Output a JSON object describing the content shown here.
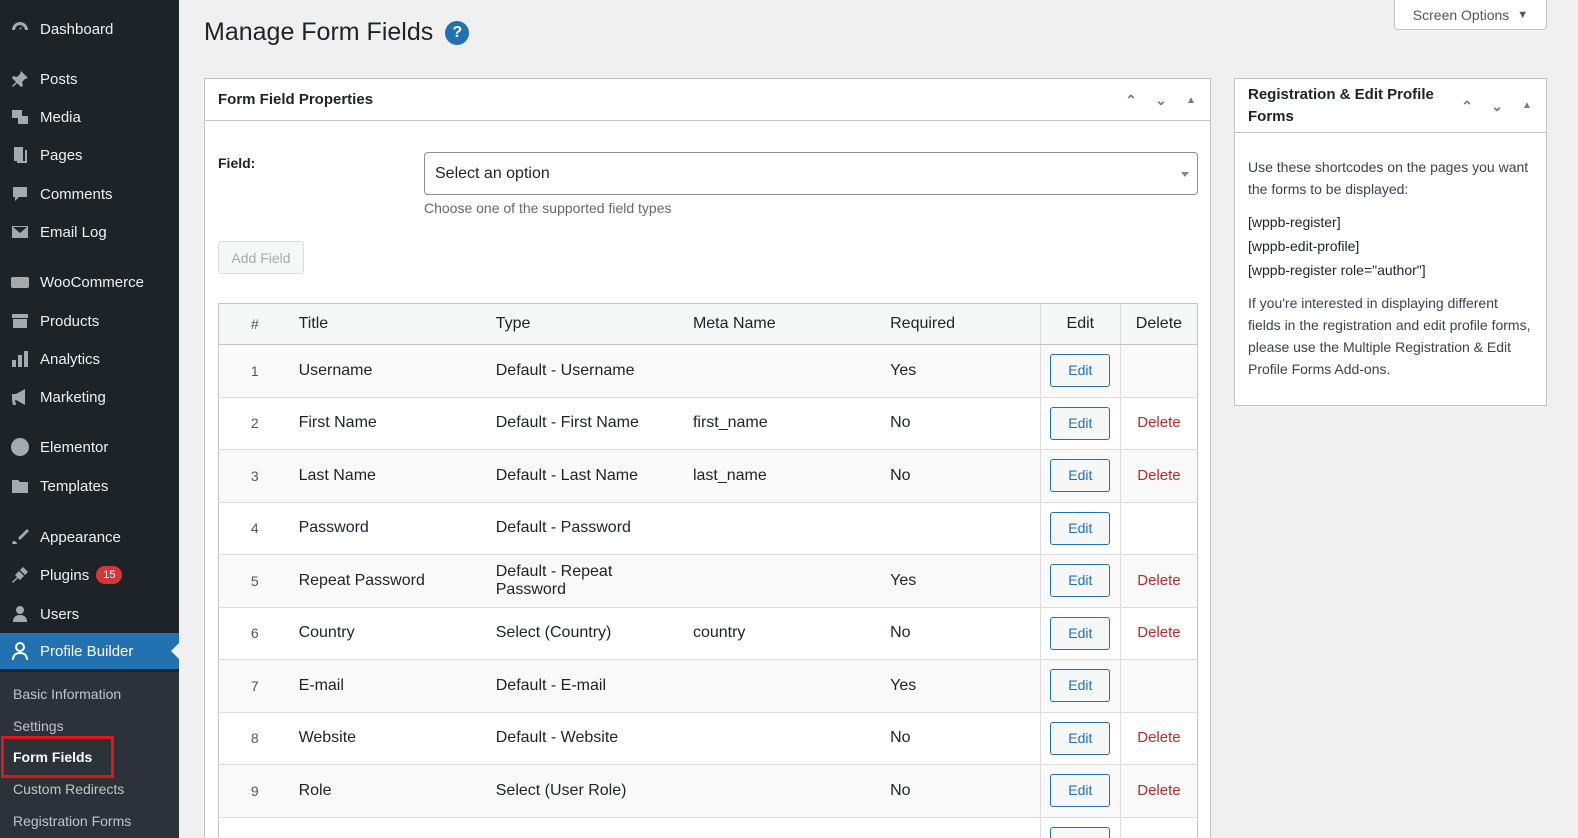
{
  "sidebar": {
    "items": [
      {
        "label": "Dashboard",
        "icon": "dashboard-icon"
      },
      {
        "label": "Posts",
        "icon": "pin-icon"
      },
      {
        "label": "Media",
        "icon": "media-icon"
      },
      {
        "label": "Pages",
        "icon": "pages-icon"
      },
      {
        "label": "Comments",
        "icon": "comment-icon"
      },
      {
        "label": "Email Log",
        "icon": "envelope-icon"
      },
      {
        "label": "WooCommerce",
        "icon": "woo-icon"
      },
      {
        "label": "Products",
        "icon": "archive-icon"
      },
      {
        "label": "Analytics",
        "icon": "bar-chart-icon"
      },
      {
        "label": "Marketing",
        "icon": "megaphone-icon"
      },
      {
        "label": "Elementor",
        "icon": "elementor-icon"
      },
      {
        "label": "Templates",
        "icon": "folder-icon"
      },
      {
        "label": "Appearance",
        "icon": "brush-icon"
      },
      {
        "label": "Plugins",
        "icon": "plug-icon",
        "badge": "15"
      },
      {
        "label": "Users",
        "icon": "user-icon"
      },
      {
        "label": "Profile Builder",
        "icon": "profile-icon"
      }
    ],
    "submenu": [
      "Basic Information",
      "Settings",
      "Form Fields",
      "Custom Redirects",
      "Registration Forms"
    ]
  },
  "header": {
    "title": "Manage Form Fields",
    "help": "?",
    "screen_options": "Screen Options",
    "screen_options_caret": "▼"
  },
  "form_box": {
    "title": "Form Field Properties",
    "field_label": "Field:",
    "select_value": "Select an option",
    "description": "Choose one of the supported field types",
    "add_button": "Add Field"
  },
  "table": {
    "headers": [
      "#",
      "Title",
      "Type",
      "Meta Name",
      "Required",
      "Edit",
      "Delete"
    ],
    "rows": [
      {
        "num": "1",
        "title": "Username",
        "type": "Default - Username",
        "meta": "",
        "required": "Yes",
        "edit": "Edit",
        "delete": ""
      },
      {
        "num": "2",
        "title": "First Name",
        "type": "Default - First Name",
        "meta": "first_name",
        "required": "No",
        "edit": "Edit",
        "delete": "Delete"
      },
      {
        "num": "3",
        "title": "Last Name",
        "type": "Default - Last Name",
        "meta": "last_name",
        "required": "No",
        "edit": "Edit",
        "delete": "Delete"
      },
      {
        "num": "4",
        "title": "Password",
        "type": "Default - Password",
        "meta": "",
        "required": "",
        "edit": "Edit",
        "delete": ""
      },
      {
        "num": "5",
        "title": "Repeat Password",
        "type": "Default - Repeat Password",
        "meta": "",
        "required": "Yes",
        "edit": "Edit",
        "delete": "Delete"
      },
      {
        "num": "6",
        "title": "Country",
        "type": "Select (Country)",
        "meta": "country",
        "required": "No",
        "edit": "Edit",
        "delete": "Delete"
      },
      {
        "num": "7",
        "title": "E-mail",
        "type": "Default - E-mail",
        "meta": "",
        "required": "Yes",
        "edit": "Edit",
        "delete": ""
      },
      {
        "num": "8",
        "title": "Website",
        "type": "Default - Website",
        "meta": "",
        "required": "No",
        "edit": "Edit",
        "delete": "Delete"
      },
      {
        "num": "9",
        "title": "Role",
        "type": "Select (User Role)",
        "meta": "",
        "required": "No",
        "edit": "Edit",
        "delete": "Delete"
      },
      {
        "num": "",
        "title": "",
        "type": "",
        "meta": "",
        "required": "",
        "edit": "Edit",
        "delete": ""
      }
    ]
  },
  "side_box": {
    "title": "Registration & Edit Profile Forms",
    "intro": "Use these shortcodes on the pages you want the forms to be displayed:",
    "shortcodes": [
      "[wppb-register]",
      "[wppb-edit-profile]",
      "[wppb-register role=\"author\"]"
    ],
    "outro": "If you're interested in displaying different fields in the registration and edit profile forms, please use the Multiple Registration & Edit Profile Forms Add-ons."
  },
  "colors": {
    "sidebar_bg": "#1d2327",
    "accent": "#2271b1",
    "delete": "#b32d2e",
    "highlight": "#e0161e"
  }
}
